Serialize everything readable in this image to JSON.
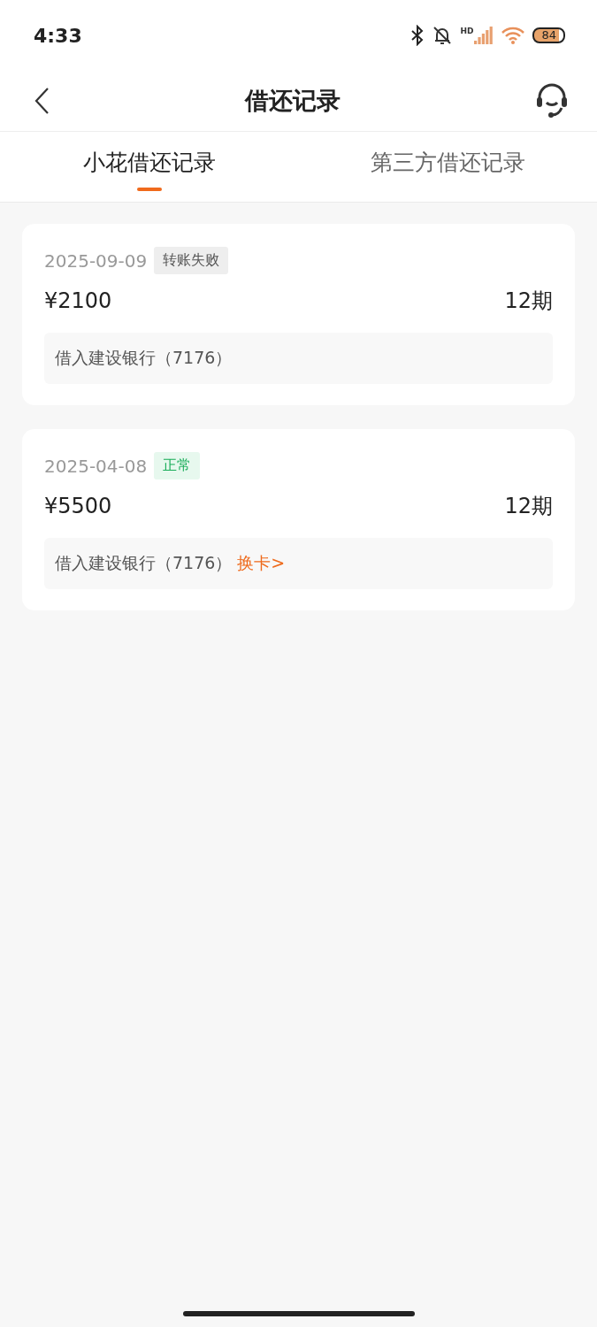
{
  "status_bar": {
    "time": "4:33",
    "network": "HD",
    "battery": "84"
  },
  "header": {
    "title": "借还记录"
  },
  "tabs": [
    {
      "label": "小花借还记录",
      "selected": true
    },
    {
      "label": "第三方借还记录",
      "selected": false
    }
  ],
  "records": [
    {
      "date": "2025-09-09",
      "status": {
        "label": "转账失败",
        "kind": "failed"
      },
      "amount": "¥2100",
      "term": "12期",
      "bank": "借入建设银行（7176）"
    },
    {
      "date": "2025-04-08",
      "status": {
        "label": "正常",
        "kind": "normal"
      },
      "amount": "¥5500",
      "term": "12期",
      "bank": "借入建设银行（7176）",
      "link": "换卡>"
    }
  ]
}
